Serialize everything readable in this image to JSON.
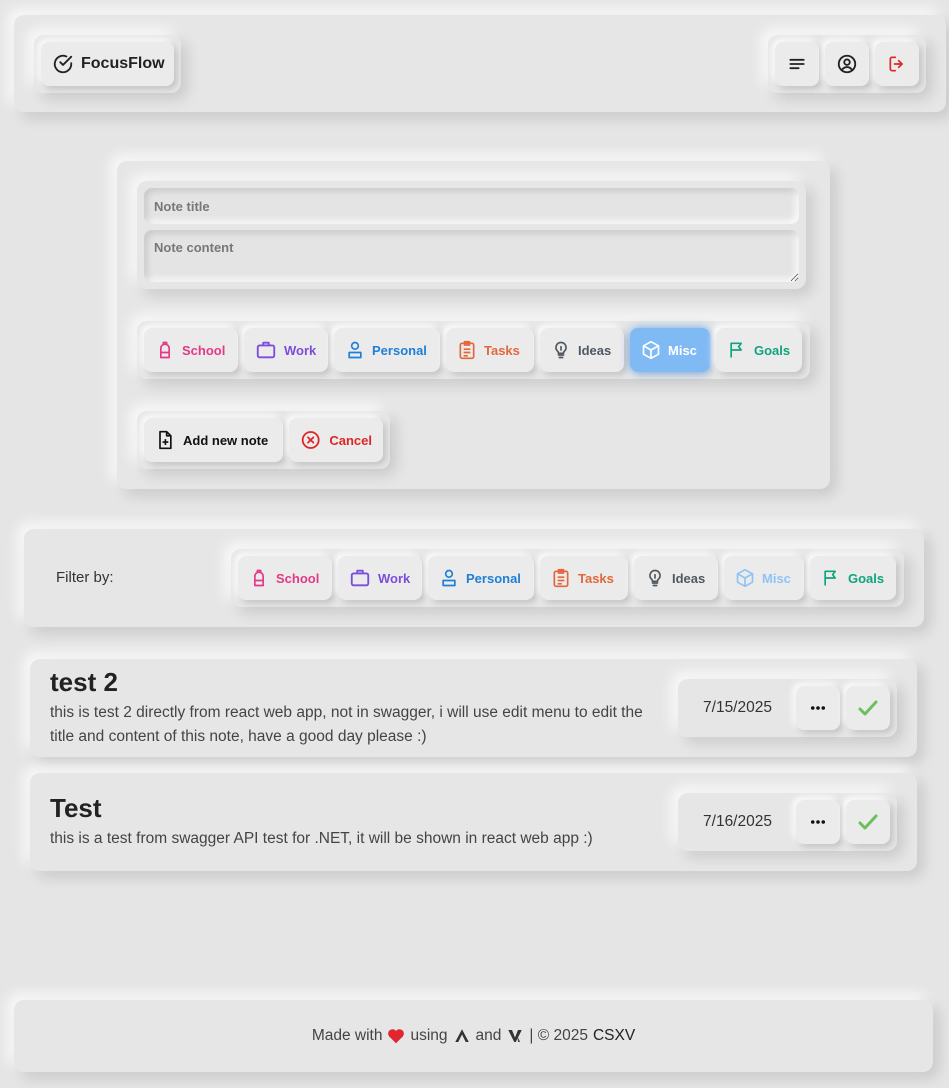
{
  "header": {
    "brand_name": "FocusFlow",
    "nav": [
      {
        "icon": "menu-icon",
        "color": "#222222"
      },
      {
        "icon": "user-icon",
        "color": "#222222"
      },
      {
        "icon": "logout-icon",
        "color": "#dc2626"
      }
    ]
  },
  "editor": {
    "title_placeholder": "Note title",
    "content_placeholder": "Note content",
    "categories": [
      {
        "label": "School",
        "icon": "backpack-icon",
        "color": "#e13a86",
        "active": false
      },
      {
        "label": "Work",
        "icon": "briefcase-icon",
        "color": "#7c4ddc",
        "active": false
      },
      {
        "label": "Personal",
        "icon": "person-icon",
        "color": "#1f7fd6",
        "active": true,
        "active_note": "Misc is highlighted"
      },
      {
        "label": "Tasks",
        "icon": "clipboard-icon",
        "color": "#e2683c",
        "active": false
      },
      {
        "label": "Ideas",
        "icon": "lightbulb-icon",
        "color": "#4f5861",
        "active": false
      },
      {
        "label": "Misc",
        "icon": "cube-icon",
        "color": "#4a9cf0",
        "active": true
      },
      {
        "label": "Goals",
        "icon": "flag-icon",
        "color": "#10a37f",
        "active": false
      }
    ],
    "add_label": "Add new note",
    "cancel_label": "Cancel"
  },
  "filter": {
    "label": "Filter by:",
    "categories": [
      "School",
      "Work",
      "Personal",
      "Tasks",
      "Ideas",
      "Misc",
      "Goals"
    ]
  },
  "notes": [
    {
      "title": "test 2",
      "content": "this is test 2 directly from react web app, not in swagger, i will use edit menu to edit the title and content of this note, have a good day please :)",
      "date": "7/15/2025"
    },
    {
      "title": "Test",
      "content": "this is a test from swagger API test for .NET, it will be shown in react web app :)",
      "date": "7/16/2025"
    }
  ],
  "footer": {
    "made_with": "Made with",
    "using": "using",
    "and": "and",
    "copyright": "| © 2025",
    "author": "CSXV"
  },
  "colors": {
    "background": "#e5e5e5",
    "heart": "#e0262f",
    "check": "#6cbf5a",
    "cancel": "#dc2626"
  }
}
